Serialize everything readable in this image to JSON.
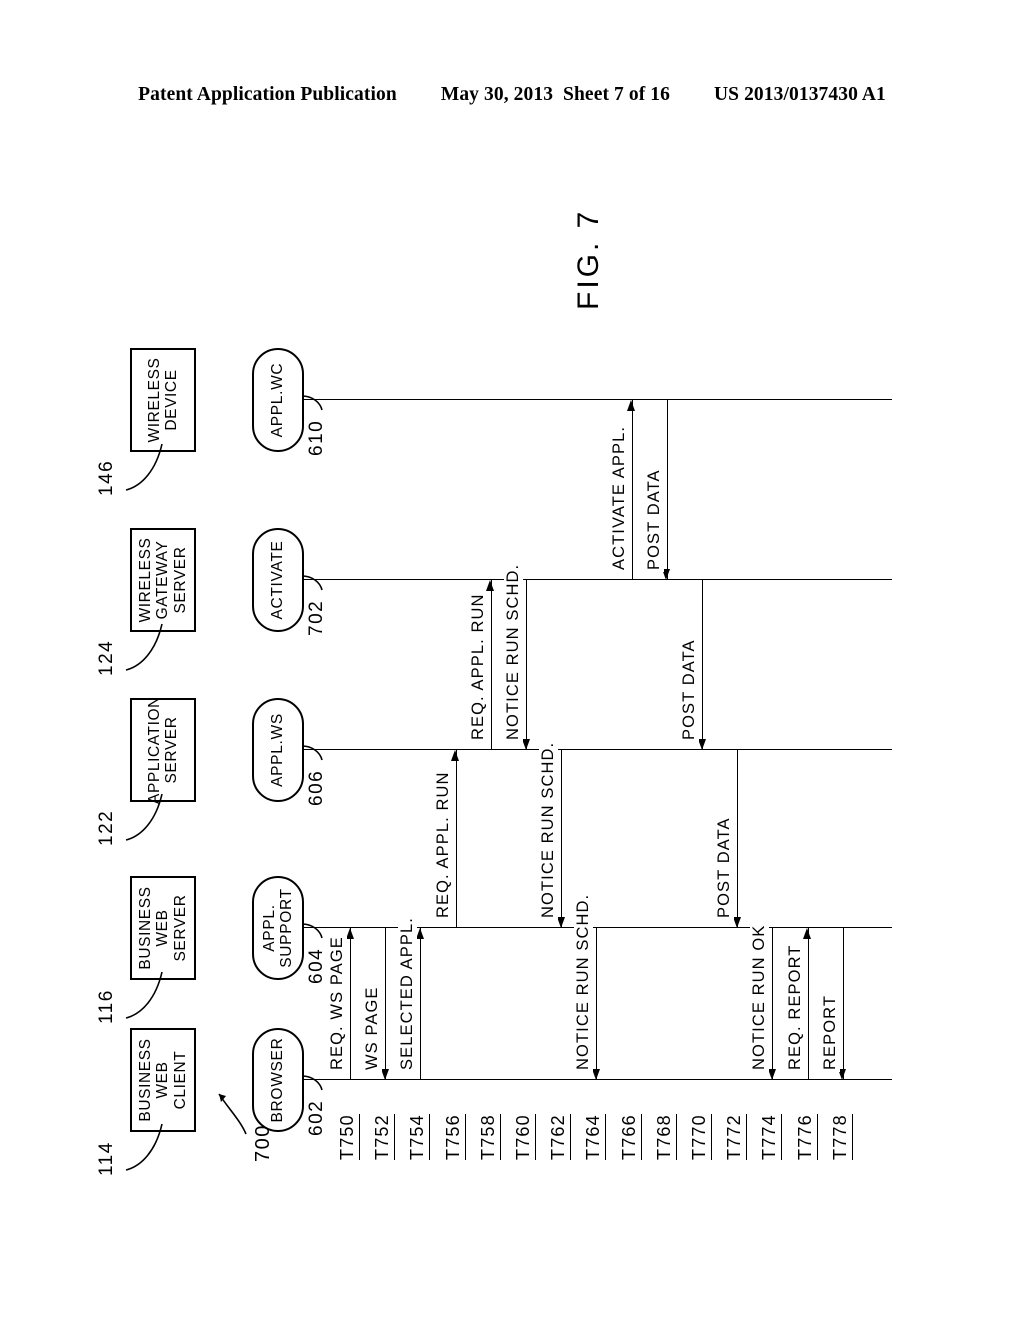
{
  "header": {
    "publication": "Patent Application Publication",
    "date": "May 30, 2013",
    "sheet": "Sheet 7 of 16",
    "patent_number": "US 2013/0137430 A1"
  },
  "figure": {
    "caption": "FIG. 7",
    "figure_id": "700"
  },
  "actors": [
    {
      "ref": "114",
      "lines": [
        "BUSINESS",
        "WEB",
        "CLIENT"
      ]
    },
    {
      "ref": "116",
      "lines": [
        "BUSINESS",
        "WEB",
        "SERVER"
      ]
    },
    {
      "ref": "122",
      "lines": [
        "APPLICATION",
        "SERVER"
      ]
    },
    {
      "ref": "124",
      "lines": [
        "WIRELESS",
        "GATEWAY",
        "SERVER"
      ]
    },
    {
      "ref": "146",
      "lines": [
        "WIRELESS",
        "DEVICE"
      ]
    }
  ],
  "lifelines": [
    {
      "ref": "602",
      "lines": [
        "BROWSER"
      ]
    },
    {
      "ref": "604",
      "lines": [
        "APPL.",
        "SUPPORT"
      ]
    },
    {
      "ref": "606",
      "lines": [
        "APPL.WS"
      ]
    },
    {
      "ref": "702",
      "lines": [
        "ACTIVATE"
      ]
    },
    {
      "ref": "610",
      "lines": [
        "APPL.WC"
      ]
    }
  ],
  "time_markers": [
    "T750",
    "T752",
    "T754",
    "T756",
    "T758",
    "T760",
    "T762",
    "T764",
    "T766",
    "T768",
    "T770",
    "T772",
    "T774",
    "T776",
    "T778"
  ],
  "messages": [
    {
      "label": "REQ. WS PAGE",
      "from": 0,
      "to": 1,
      "time": "T750",
      "direction": "right"
    },
    {
      "label": "WS PAGE",
      "from": 1,
      "to": 0,
      "time": "T752",
      "direction": "left"
    },
    {
      "label": "SELECTED APPL.",
      "from": 0,
      "to": 1,
      "time": "T754",
      "direction": "right"
    },
    {
      "label": "REQ. APPL. RUN",
      "from": 1,
      "to": 2,
      "time": "T756",
      "direction": "right"
    },
    {
      "label": "REQ. APPL. RUN",
      "from": 2,
      "to": 3,
      "time": "T758",
      "direction": "right"
    },
    {
      "label": "NOTICE RUN SCHD.",
      "from": 3,
      "to": 2,
      "time": "T760",
      "direction": "left"
    },
    {
      "label": "NOTICE RUN SCHD.",
      "from": 2,
      "to": 1,
      "time": "T762",
      "direction": "left"
    },
    {
      "label": "NOTICE RUN SCHD.",
      "from": 1,
      "to": 0,
      "time": "T764",
      "direction": "left"
    },
    {
      "label": "ACTIVATE APPL.",
      "from": 3,
      "to": 4,
      "time": "T766",
      "direction": "right"
    },
    {
      "label": "POST DATA",
      "from": 4,
      "to": 3,
      "time": "T768",
      "direction": "left"
    },
    {
      "label": "POST DATA",
      "from": 3,
      "to": 2,
      "time": "T770",
      "direction": "left"
    },
    {
      "label": "POST DATA",
      "from": 2,
      "to": 1,
      "time": "T772",
      "direction": "left"
    },
    {
      "label": "NOTICE RUN OK",
      "from": 1,
      "to": 0,
      "time": "T774",
      "direction": "left"
    },
    {
      "label": "REQ. REPORT",
      "from": 0,
      "to": 1,
      "time": "T776",
      "direction": "right"
    },
    {
      "label": "REPORT",
      "from": 1,
      "to": 0,
      "time": "T778",
      "direction": "left"
    }
  ]
}
